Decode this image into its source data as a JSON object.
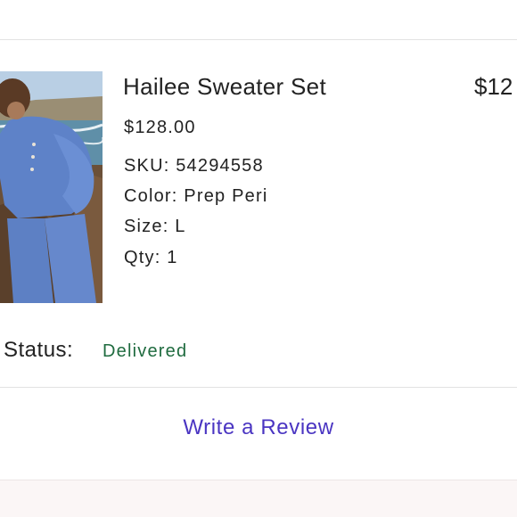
{
  "order_item": {
    "title": "Hailee Sweater Set",
    "total_price": "$12",
    "price": "$128.00",
    "sku": "SKU: 54294558",
    "color": "Color: Prep Peri",
    "size": "Size: L",
    "qty": "Qty: 1",
    "image_icon": "product-photo"
  },
  "status": {
    "label": "Status:",
    "value": "Delivered",
    "value_color": "#1f6b3f"
  },
  "actions": {
    "review_label": "Write a Review",
    "review_color": "#4a35c2"
  }
}
